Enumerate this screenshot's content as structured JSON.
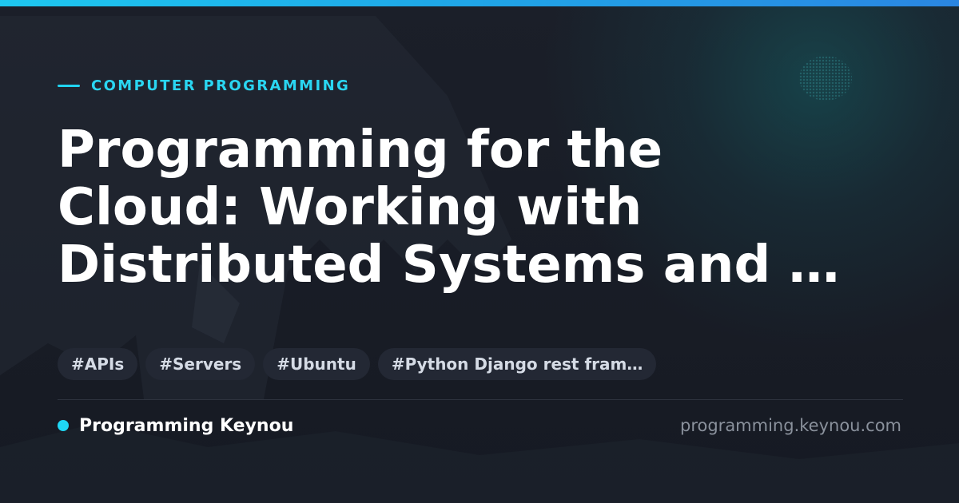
{
  "category": {
    "label": "COMPUTER PROGRAMMING"
  },
  "article": {
    "title_lines": [
      "Programming for the",
      "Cloud: Working with",
      "Distributed Systems and …"
    ]
  },
  "tags": [
    "#APIs",
    "#Servers",
    "#Ubuntu",
    "#Python Django rest fram…"
  ],
  "footer": {
    "brand_name": "Programming Keynou",
    "site_url": "programming.keynou.com"
  },
  "colors": {
    "accent": "#20d3f0",
    "background": "#171b24",
    "title_text": "#ffffff",
    "tag_background": "#232834",
    "tag_text": "#d5dbe5",
    "url_text": "#8a919c"
  }
}
